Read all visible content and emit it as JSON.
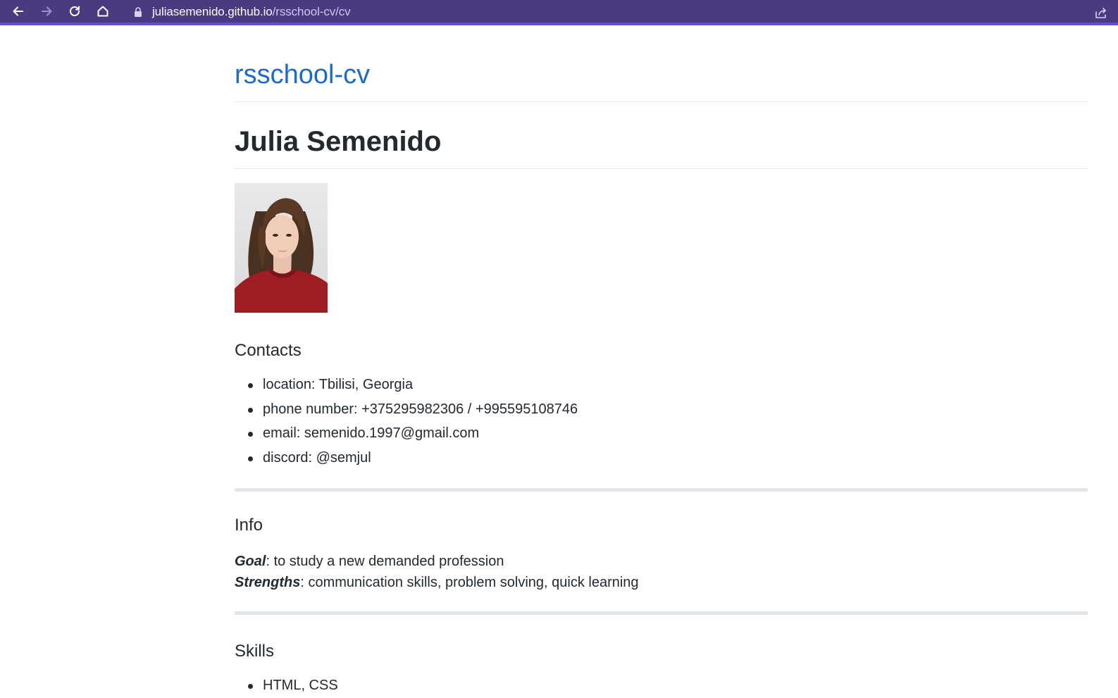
{
  "browser": {
    "url_host": "juliasemenido.github.io",
    "url_path": "/rsschool-cv/cv"
  },
  "page": {
    "site_title": "rsschool-cv",
    "name": "Julia Semenido",
    "contacts": {
      "heading": "Contacts",
      "items": [
        "location: Tbilisi, Georgia",
        "phone number: +375295982306 / +995595108746",
        "email: semenido.1997@gmail.com",
        "discord: @semjul"
      ]
    },
    "info": {
      "heading": "Info",
      "goal_label": "Goal",
      "goal_text": ": to study a new demanded profession",
      "strengths_label": "Strengths",
      "strengths_text": ": communication skills, problem solving, quick learning"
    },
    "skills": {
      "heading": "Skills",
      "items": [
        "HTML, CSS"
      ]
    }
  },
  "colors": {
    "toolbar": "#4a3a80",
    "accent_bar": "#6a4fc4",
    "link": "#1e6bc6",
    "text": "#24292e",
    "divider": "#e1e4e8"
  },
  "icons": [
    "back-arrow-icon",
    "forward-arrow-icon",
    "reload-icon",
    "home-icon",
    "lock-icon",
    "share-icon"
  ]
}
